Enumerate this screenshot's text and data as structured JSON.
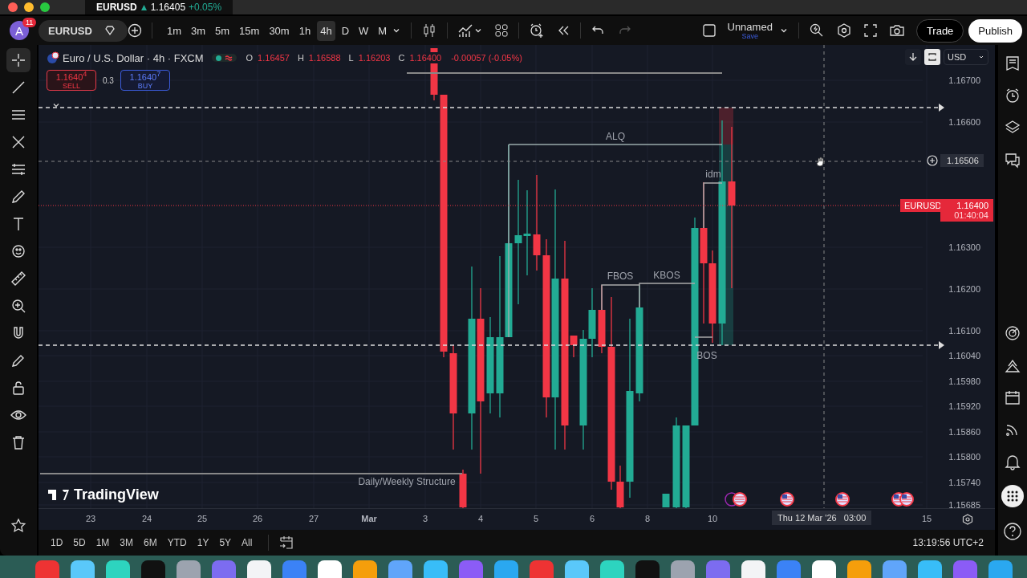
{
  "browser_tab": {
    "symbol": "EURUSD",
    "rising": true,
    "price": "1.16405",
    "change": "+0.05%"
  },
  "toolbar": {
    "avatar": "A",
    "notifications": "11",
    "symbol": "EURUSD",
    "intervals": [
      {
        "label": "1m",
        "selected": false
      },
      {
        "label": "3m",
        "selected": false
      },
      {
        "label": "5m",
        "selected": false
      },
      {
        "label": "15m",
        "selected": false
      },
      {
        "label": "30m",
        "selected": false
      },
      {
        "label": "1h",
        "selected": false
      },
      {
        "label": "4h",
        "selected": true
      },
      {
        "label": "D",
        "selected": false
      },
      {
        "label": "W",
        "selected": false
      },
      {
        "label": "M",
        "selected": false
      }
    ],
    "layout_name": "Unnamed",
    "save": "Save",
    "trade": "Trade",
    "publish": "Publish"
  },
  "legend": {
    "title": "Euro / U.S. Dollar · 4h · FXCM",
    "ohlc": [
      {
        "label": "O",
        "value": "1.16457"
      },
      {
        "label": "H",
        "value": "1.16588"
      },
      {
        "label": "L",
        "value": "1.16203"
      },
      {
        "label": "C",
        "value": "1.16400"
      }
    ],
    "change": "-0.00057 (-0.05%)",
    "sell": {
      "price": "1.1640$^{4}$",
      "label": "SELL"
    },
    "spread": "0.3",
    "buy": {
      "price": "1.1640$^{7}$",
      "label": "BUY"
    }
  },
  "currency": "USD",
  "annotations": [
    {
      "text": "ALQ"
    },
    {
      "text": "idm"
    },
    {
      "text": "FBOS"
    },
    {
      "text": "KBOS"
    },
    {
      "text": "BOS"
    },
    {
      "text": "Daily/Weekly Structure"
    }
  ],
  "price_axis": [
    "1.16700",
    "1.16600",
    "1.16300",
    "1.16200",
    "1.16100",
    "1.16040",
    "1.15980",
    "1.15920",
    "1.15860",
    "1.15800",
    "1.15740",
    "1.15685"
  ],
  "crosshair_price": "1.16506",
  "last_price": {
    "symbol": "EURUSD",
    "price": "1.16400",
    "countdown": "01:40:04"
  },
  "logo": "TradingView",
  "time_axis": [
    "23",
    "24",
    "25",
    "26",
    "27",
    "Mar",
    "3",
    "4",
    "5",
    "6",
    "8",
    "10",
    "15"
  ],
  "crosshair_time": "Thu 12 Mar '26   03:00",
  "ranges": [
    "1D",
    "5D",
    "1M",
    "3M",
    "6M",
    "YTD",
    "1Y",
    "5Y",
    "All"
  ],
  "clock": "13:19:56 UTC+2"
}
